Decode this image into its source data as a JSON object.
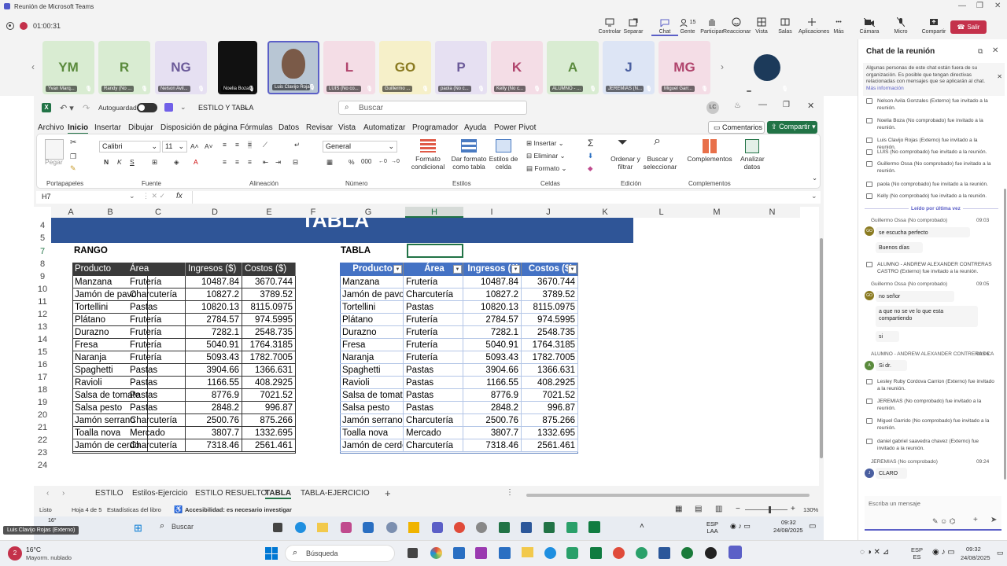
{
  "teams": {
    "window_title": "Reunión de Microsoft Teams",
    "timer": "01:00:31",
    "toolbar": [
      "Controlar",
      "Separar",
      "Chat",
      "Gente",
      "Participar",
      "Reaccionar",
      "Vista",
      "Salas",
      "Aplicaciones",
      "Más",
      "Cámara",
      "Micro",
      "Compartir"
    ],
    "people_count": "15",
    "leave": "Salir",
    "participants": [
      {
        "initials": "YM",
        "name": "Yvan Marq...",
        "bg": "#d9ecd2",
        "fg": "#5a8a3c"
      },
      {
        "initials": "R",
        "name": "Randy (No ...",
        "bg": "#d9ecd2",
        "fg": "#5a8a3c"
      },
      {
        "initials": "NG",
        "name": "Nelson Avil...",
        "bg": "#e6e0f2",
        "fg": "#6b5a99"
      },
      {
        "initials": "",
        "name": "Noelia Boza...",
        "bg": "#111",
        "fg": "#fff"
      },
      {
        "initials": "",
        "name": "Luis Clavijo Roja...",
        "bg": "#b8c6d4",
        "fg": "#fff"
      },
      {
        "initials": "L",
        "name": "LUIS (No co...",
        "bg": "#f4dde6",
        "fg": "#b0436c"
      },
      {
        "initials": "GO",
        "name": "Guillermo ...",
        "bg": "#f6f0c9",
        "fg": "#8a7a20"
      },
      {
        "initials": "P",
        "name": "paola (No c...",
        "bg": "#e6e0f2",
        "fg": "#6b5a99"
      },
      {
        "initials": "K",
        "name": "Kelly (No c...",
        "bg": "#f4dde6",
        "fg": "#b0436c"
      },
      {
        "initials": "A",
        "name": "ALUMNO - ...",
        "bg": "#d9ecd2",
        "fg": "#5a8a3c"
      },
      {
        "initials": "J",
        "name": "JEREMIAS (N...",
        "bg": "#dde5f5",
        "fg": "#4a5fa0"
      },
      {
        "initials": "MG",
        "name": "Miguel Garr...",
        "bg": "#f4dde6",
        "fg": "#b0436c"
      },
      {
        "initials": "",
        "name": "",
        "bg": "#f3f3f3",
        "fg": "#333"
      }
    ],
    "presenter_label": "Luis Clavijo Rojas (Externo)"
  },
  "excel": {
    "autosave": "Autoguardado",
    "filename": "ESTILO Y TABLA",
    "search": "Buscar",
    "avatar": "LC",
    "menus": [
      "Archivo",
      "Inicio",
      "Insertar",
      "Dibujar",
      "Disposición de página",
      "Fórmulas",
      "Datos",
      "Revisar",
      "Vista",
      "Automatizar",
      "Programador",
      "Ayuda",
      "Power Pivot"
    ],
    "comments": "Comentarios",
    "share": "Compartir",
    "ribbon": {
      "paste": "Pegar",
      "font": "Calibri",
      "size": "11",
      "numfmt": "General",
      "insert": "Insertar",
      "delete": "Eliminar",
      "format": "Formato",
      "cond": "Formato condicional",
      "table": "Dar formato como tabla",
      "styles": "Estilos de celda",
      "sort": "Ordenar y filtrar",
      "find": "Buscar y seleccionar",
      "addins": "Complementos",
      "analyze": "Analizar datos",
      "groups": [
        "Portapapeles",
        "Fuente",
        "Alineación",
        "Número",
        "Estilos",
        "Celdas",
        "Edición",
        "Complementos"
      ]
    },
    "namebox": "H7",
    "fx": "fx",
    "columns": [
      "A",
      "B",
      "C",
      "D",
      "E",
      "F",
      "G",
      "H",
      "I",
      "J",
      "K",
      "L",
      "M",
      "N"
    ],
    "rows": [
      "4",
      "5",
      "7",
      "8",
      "9",
      "10",
      "11",
      "12",
      "13",
      "14",
      "15",
      "16",
      "17",
      "18",
      "19",
      "20",
      "21",
      "22",
      "23",
      "24"
    ],
    "banner": "TABLA",
    "rango_label": "RANGO",
    "tabla_label": "TABLA",
    "headers": [
      "Producto",
      "Área",
      "Ingresos ($)",
      "Costos ($)"
    ],
    "range_rows": [
      [
        "Manzana",
        "Frutería",
        "10487.84",
        "3670.744"
      ],
      [
        "Jamón de pavo",
        "Charcutería",
        "10827.2",
        "3789.52"
      ],
      [
        "Tortellini",
        "Pastas",
        "10820.13",
        "8115.0975"
      ],
      [
        "Plátano",
        "Frutería",
        "2784.57",
        "974.5995"
      ],
      [
        "Durazno",
        "Frutería",
        "7282.1",
        "2548.735"
      ],
      [
        "Fresa",
        "Frutería",
        "5040.91",
        "1764.3185"
      ],
      [
        "Naranja",
        "Frutería",
        "5093.43",
        "1782.7005"
      ],
      [
        "Spaghetti",
        "Pastas",
        "3904.66",
        "1366.631"
      ],
      [
        "Ravioli",
        "Pastas",
        "1166.55",
        "408.2925"
      ],
      [
        "Salsa de tomate",
        "Pastas",
        "8776.9",
        "7021.52"
      ],
      [
        "Salsa pesto",
        "Pastas",
        "2848.2",
        "996.87"
      ],
      [
        "Jamón serrano",
        "Charcutería",
        "2500.76",
        "875.266"
      ],
      [
        "Toalla nova",
        "Mercado",
        "3807.7",
        "1332.695"
      ],
      [
        "Jamón de cerdo",
        "Charcutería",
        "7318.46",
        "2561.461"
      ]
    ],
    "sheets": [
      "ESTILO",
      "Estilos-Ejercicio",
      "ESTILO RESUELTO",
      "TABLA",
      "TABLA-EJERCICIO"
    ],
    "active_sheet": "TABLA",
    "status": {
      "ready": "Listo",
      "sheet": "Hoja 4 de 5",
      "stats": "Estadísticas del libro",
      "access": "Accesibilidad: es necesario investigar",
      "zoom": "130%"
    }
  },
  "inner_taskbar": {
    "weather": "16°",
    "search": "Buscar",
    "lang": "ESP\nLAA",
    "time": "09:32",
    "date": "24/08/2025"
  },
  "chat": {
    "title": "Chat de la reunión",
    "notice": "Algunas personas de este chat están fuera de su organización. Es posible que tengan directivas relacionadas con mensajes que se aplicarán al chat.",
    "notice_link": "Más información",
    "events": [
      "Nelson Avila Gonzales (Externo) fue invitado a la reunión.",
      "Noelia Boza (No comprobado) fue invitado a la reunión.",
      "Luis Clavijo Rojas (Externo) fue invitado a la reunión.",
      "LUIS (No comprobado) fue invitado a la reunión.",
      "Guillermo Ossa (No comprobado) fue invitado a la reunión.",
      "paola (No comprobado) fue invitado a la reunión.",
      "Kelly (No comprobado) fue invitado a la reunión."
    ],
    "read": "Leído por última vez",
    "m1_author": "Guillermo Ossa (No comprobado)",
    "m1_time": "09:03",
    "m1_a": "se escucha perfecto",
    "m1_b": "Buenos días",
    "ev2": "ALUMNO - ANDREW ALEXANDER CONTRERAS CASTRO (Externo) fue invitado a la reunión.",
    "m2_author": "Guillermo Ossa (No comprobado)",
    "m2_time": "09:05",
    "m2_a": "no señor",
    "m2_b": "a que no se ve lo que esta compartiendo",
    "m2_c": "si",
    "m3_author": "ALUMNO - ANDREW ALEXANDER CONTRERAS CA",
    "m3_time": "09:06",
    "m3_a": "Si dr.",
    "ev3": "Lesley Ruby Cordova Carrion (Externo) fue invitado a la reunión.",
    "ev4": "JEREMIAS (No comprobado) fue invitado a la reunión.",
    "ev5": "Miguel Garrido (No comprobado) fue invitado a la reunión.",
    "ev6": "daniel gabriel saavedra chavez (Externo) fue invitado a la reunión.",
    "m4_author": "JEREMIAS (No comprobado)",
    "m4_time": "09:24",
    "m4_a": "CLARO",
    "input": "Escriba un mensaje"
  },
  "win": {
    "temp": "16°C",
    "weather": "Mayorm. nublado",
    "search": "Búsqueda",
    "lang": "ESP\nES",
    "time": "09:32",
    "date": "24/08/2025"
  }
}
